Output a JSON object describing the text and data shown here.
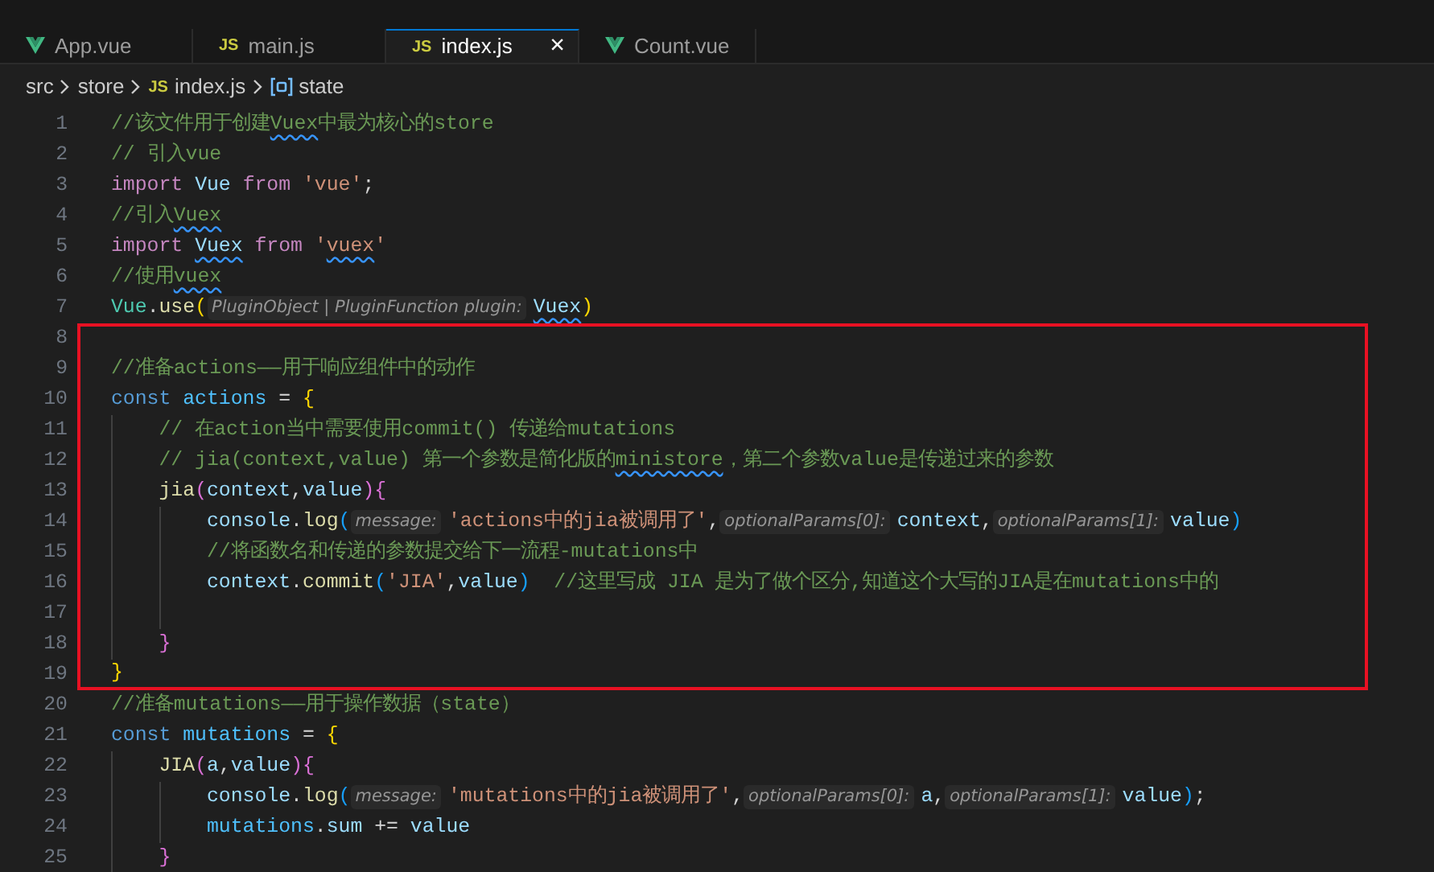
{
  "tabs": [
    {
      "label": "App.vue",
      "kind": "vue",
      "selected": false
    },
    {
      "label": "main.js",
      "kind": "js",
      "icon_text": "JS",
      "selected": false
    },
    {
      "label": "index.js",
      "kind": "js",
      "icon_text": "JS",
      "selected": true,
      "close": "×"
    },
    {
      "label": "Count.vue",
      "kind": "vue",
      "selected": false
    }
  ],
  "breadcrumbs": [
    {
      "label": "src",
      "kind": "folder"
    },
    {
      "label": "store",
      "kind": "folder"
    },
    {
      "label": "index.js",
      "kind": "js",
      "icon_text": "JS"
    },
    {
      "label": "state",
      "kind": "symbol"
    }
  ],
  "lines": [
    {
      "number": "1",
      "boxed": false,
      "tokens": [
        {
          "kind": "c",
          "t": "//该文件用于创建"
        },
        {
          "kind": "c",
          "t": "Vuex",
          "squiggle": true
        },
        {
          "kind": "c",
          "t": "中最为核心的store"
        }
      ]
    },
    {
      "number": "2",
      "boxed": false,
      "tokens": [
        {
          "kind": "c",
          "t": "// 引入vue"
        }
      ]
    },
    {
      "number": "3",
      "boxed": false,
      "tokens": [
        {
          "kind": "kw",
          "t": "import "
        },
        {
          "kind": "v",
          "t": "Vue "
        },
        {
          "kind": "kw",
          "t": "from "
        },
        {
          "kind": "s",
          "t": "'vue'"
        },
        {
          "kind": "p",
          "t": ";"
        }
      ]
    },
    {
      "number": "4",
      "boxed": false,
      "tokens": [
        {
          "kind": "c",
          "t": "//引入"
        },
        {
          "kind": "c",
          "t": "Vuex",
          "squiggle": true
        }
      ]
    },
    {
      "number": "5",
      "boxed": false,
      "tokens": [
        {
          "kind": "kw",
          "t": "import "
        },
        {
          "kind": "v",
          "t": "Vuex",
          "squiggle": true
        },
        {
          "kind": "kw",
          "t": " from "
        },
        {
          "kind": "s",
          "t": "'"
        },
        {
          "kind": "s",
          "t": "vuex",
          "squiggle": true
        },
        {
          "kind": "s",
          "t": "'"
        }
      ]
    },
    {
      "number": "6",
      "boxed": false,
      "tokens": [
        {
          "kind": "c",
          "t": "//使用"
        },
        {
          "kind": "c",
          "t": "vuex",
          "squiggle": true
        }
      ]
    },
    {
      "number": "7",
      "boxed": false,
      "tokens": [
        {
          "kind": "cls",
          "t": "Vue"
        },
        {
          "kind": "p",
          "t": "."
        },
        {
          "kind": "f",
          "t": "use"
        },
        {
          "kind": "b1",
          "t": "("
        },
        {
          "kind": "h",
          "t": "PluginObject | PluginFunction plugin:"
        },
        {
          "kind": "v",
          "t": "Vuex",
          "squiggle": true
        },
        {
          "kind": "b1",
          "t": ")"
        }
      ]
    },
    {
      "number": "8",
      "boxed": true
    },
    {
      "number": "9",
      "boxed": true,
      "tokens": [
        {
          "kind": "c",
          "t": "//准备actions——用于响应组件中的动作"
        }
      ]
    },
    {
      "number": "10",
      "boxed": true,
      "tokens": [
        {
          "kind": "st",
          "t": "const "
        },
        {
          "kind": "cn",
          "t": "actions"
        },
        {
          "kind": "p",
          "t": " = "
        },
        {
          "kind": "b1",
          "t": "{"
        }
      ]
    },
    {
      "number": "11",
      "boxed": true,
      "tokens": [
        {
          "kind": "c",
          "t": "    // 在action当中需要使用commit() 传递给mutations"
        }
      ]
    },
    {
      "number": "12",
      "boxed": true,
      "tokens": [
        {
          "kind": "c",
          "t": "    // jia(context,value) 第一个参数是简化版的"
        },
        {
          "kind": "c",
          "t": "ministore",
          "squiggle": true
        },
        {
          "kind": "c",
          "t": "，第二个参数value是传递过来的参数"
        }
      ]
    },
    {
      "number": "13",
      "boxed": true,
      "tokens": [
        {
          "kind": "f",
          "t": "    jia"
        },
        {
          "kind": "b2",
          "t": "("
        },
        {
          "kind": "v",
          "t": "context"
        },
        {
          "kind": "p",
          "t": ","
        },
        {
          "kind": "v",
          "t": "value"
        },
        {
          "kind": "b2",
          "t": "){"
        }
      ]
    },
    {
      "number": "14",
      "boxed": true,
      "tokens": [
        {
          "kind": "v",
          "t": "        console"
        },
        {
          "kind": "p",
          "t": "."
        },
        {
          "kind": "f",
          "t": "log"
        },
        {
          "kind": "b3",
          "t": "("
        },
        {
          "kind": "h",
          "t": "message:"
        },
        {
          "kind": "s",
          "t": "'actions中的jia被调用了'"
        },
        {
          "kind": "p",
          "t": ","
        },
        {
          "kind": "h",
          "t": "optionalParams[0]:"
        },
        {
          "kind": "v",
          "t": "context"
        },
        {
          "kind": "p",
          "t": ","
        },
        {
          "kind": "h",
          "t": "optionalParams[1]:"
        },
        {
          "kind": "v",
          "t": "value"
        },
        {
          "kind": "b3",
          "t": ")"
        }
      ]
    },
    {
      "number": "15",
      "boxed": true,
      "tokens": [
        {
          "kind": "c",
          "t": "        //将函数名和传递的参数提交给下一流程-mutations中"
        }
      ]
    },
    {
      "number": "16",
      "boxed": true,
      "tokens": [
        {
          "kind": "v",
          "t": "        context"
        },
        {
          "kind": "p",
          "t": "."
        },
        {
          "kind": "f",
          "t": "commit"
        },
        {
          "kind": "b3",
          "t": "("
        },
        {
          "kind": "s",
          "t": "'JIA'"
        },
        {
          "kind": "p",
          "t": ","
        },
        {
          "kind": "v",
          "t": "value"
        },
        {
          "kind": "b3",
          "t": ")"
        },
        {
          "kind": "c",
          "t": "  //这里写成 JIA 是为了做个区分,知道这个大写的JIA是在mutations中的"
        }
      ]
    },
    {
      "number": "17",
      "boxed": true
    },
    {
      "number": "18",
      "boxed": true,
      "tokens": [
        {
          "kind": "b2",
          "t": "    }"
        }
      ]
    },
    {
      "number": "19",
      "boxed": true,
      "tokens": [
        {
          "kind": "b1",
          "t": "}"
        }
      ]
    },
    {
      "number": "20",
      "boxed": false,
      "tokens": [
        {
          "kind": "c",
          "t": "//准备mutations——用于操作数据（state）"
        }
      ]
    },
    {
      "number": "21",
      "boxed": false,
      "tokens": [
        {
          "kind": "st",
          "t": "const "
        },
        {
          "kind": "cn",
          "t": "mutations"
        },
        {
          "kind": "p",
          "t": " = "
        },
        {
          "kind": "b1",
          "t": "{"
        }
      ]
    },
    {
      "number": "22",
      "boxed": false,
      "tokens": [
        {
          "kind": "f",
          "t": "    JIA"
        },
        {
          "kind": "b2",
          "t": "("
        },
        {
          "kind": "v",
          "t": "a"
        },
        {
          "kind": "p",
          "t": ","
        },
        {
          "kind": "v",
          "t": "value"
        },
        {
          "kind": "b2",
          "t": "){"
        }
      ]
    },
    {
      "number": "23",
      "boxed": false,
      "tokens": [
        {
          "kind": "v",
          "t": "        console"
        },
        {
          "kind": "p",
          "t": "."
        },
        {
          "kind": "f",
          "t": "log"
        },
        {
          "kind": "b3",
          "t": "("
        },
        {
          "kind": "h",
          "t": "message:"
        },
        {
          "kind": "s",
          "t": "'mutations中的jia被调用了'"
        },
        {
          "kind": "p",
          "t": ","
        },
        {
          "kind": "h",
          "t": "optionalParams[0]:"
        },
        {
          "kind": "v",
          "t": "a"
        },
        {
          "kind": "p",
          "t": ","
        },
        {
          "kind": "h",
          "t": "optionalParams[1]:"
        },
        {
          "kind": "v",
          "t": "value"
        },
        {
          "kind": "b3",
          "t": ")"
        },
        {
          "kind": "p",
          "t": ";"
        }
      ]
    },
    {
      "number": "24",
      "boxed": false,
      "tokens": [
        {
          "kind": "cn",
          "t": "        mutations"
        },
        {
          "kind": "p",
          "t": "."
        },
        {
          "kind": "v",
          "t": "sum"
        },
        {
          "kind": "p",
          "t": " += "
        },
        {
          "kind": "v",
          "t": "value"
        }
      ]
    },
    {
      "number": "25",
      "boxed": false,
      "tokens": [
        {
          "kind": "b2",
          "t": "    }"
        }
      ]
    }
  ]
}
